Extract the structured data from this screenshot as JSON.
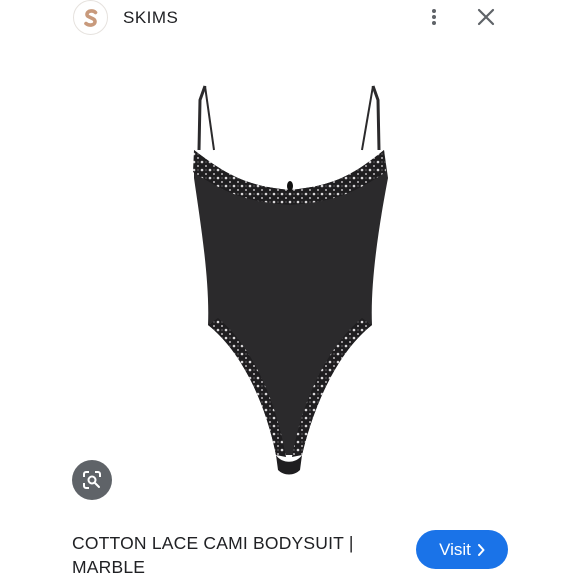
{
  "header": {
    "site_name": "SKIMS",
    "logo_letter": "S"
  },
  "product": {
    "title": "COTTON LACE CAMI BODYSUIT | MARBLE",
    "image_icon": "bodysuit-image"
  },
  "actions": {
    "visit_label": "Visit",
    "more_icon": "more-vert-icon",
    "close_icon": "close-icon",
    "lens_icon": "lens-search-icon"
  },
  "colors": {
    "accent": "#1a73e8",
    "garment": "#2b2a2c",
    "logo_letter": "#b07d5e"
  }
}
